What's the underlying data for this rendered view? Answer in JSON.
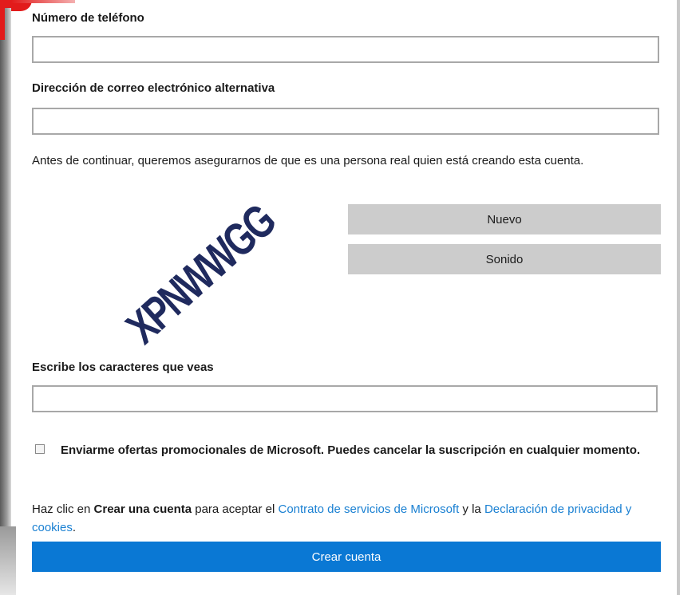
{
  "form": {
    "phone_label": "Número de teléfono",
    "phone_value": "",
    "alt_email_label": "Dirección de correo electrónico alternativa",
    "alt_email_value": "",
    "human_check_text": "Antes de continuar, queremos asegurarnos de que es una persona real quien está creando esta cuenta.",
    "captcha_text": "XPNWWGG",
    "new_button": "Nuevo",
    "audio_button": "Sonido",
    "characters_label": "Escribe los caracteres que veas",
    "characters_value": "",
    "promo_checked": false,
    "promo_text": "Enviarme ofertas promocionales de Microsoft. Puedes cancelar la suscripción en cualquier momento.",
    "terms": {
      "prefix": "Haz clic en ",
      "action": "Crear una cuenta",
      "middle": " para aceptar el ",
      "services_link": "Contrato de servicios de Microsoft",
      "and": " y la ",
      "privacy_link": "Declaración de privacidad y cookies",
      "suffix": "."
    },
    "submit_button": "Crear cuenta"
  },
  "colors": {
    "primary_button": "#0a78d4",
    "link": "#1a80d2",
    "secondary_button": "#cccccc",
    "captcha_ink": "#1f2a5e"
  }
}
